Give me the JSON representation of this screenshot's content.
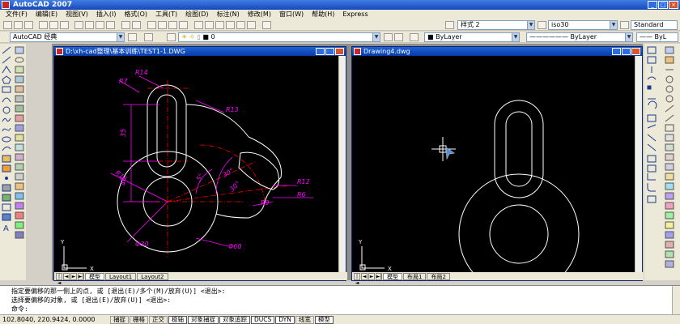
{
  "app": {
    "title": "AutoCAD 2007"
  },
  "menu": [
    "文件(F)",
    "编辑(E)",
    "视图(V)",
    "插入(I)",
    "格式(O)",
    "工具(T)",
    "绘图(D)",
    "标注(N)",
    "修改(M)",
    "窗口(W)",
    "帮助(H)",
    "Express"
  ],
  "toolbar": {
    "text_style": "样式 2",
    "dim_style": "iso30",
    "table_style": "Standard",
    "workspace": "AutoCAD 经典",
    "layer": "0",
    "color": "ByLayer",
    "linetype": "ByLayer",
    "lineweight": "ByL"
  },
  "windows": [
    {
      "title": "D:\\xh-cad整理\\基本训练\\TEST1-1.DWG",
      "tabs": [
        "模型",
        "Layout1",
        "Layout2"
      ],
      "active_tab": "模型"
    },
    {
      "title": "Drawing4.dwg",
      "tabs": [
        "模型",
        "布局1",
        "布局2"
      ],
      "active_tab": "模型"
    }
  ],
  "dims": {
    "r14": "R14",
    "r7": "R7",
    "r13": "R13",
    "r12": "R12",
    "r6": "R6",
    "r9": "R9",
    "r16": "R16",
    "d30": "Φ30",
    "d60": "Φ60",
    "v35": "35",
    "v48": "48",
    "a5": "5°",
    "a30": "30°",
    "a30b": "30°"
  },
  "ucs": {
    "x": "X",
    "y": "Y"
  },
  "command": {
    "line1": "指定要偏移的那一侧上的点, 或 [退出(E)/多个(M)/放弃(U)] <退出>:",
    "line2": "选择要偏移的对象, 或 [退出(E)/放弃(U)] <退出>:",
    "prompt": "命令:"
  },
  "status": {
    "coords": "102.8040, 220.9424, 0.0000",
    "buttons": [
      "捕捉",
      "栅格",
      "正交",
      "极轴",
      "对象捕捉",
      "对象追踪",
      "DUCS",
      "DYN",
      "线宽",
      "模型"
    ],
    "on": [
      "极轴",
      "对象捕捉",
      "对象追踪",
      "DUCS",
      "DYN",
      "模型"
    ]
  },
  "colors": {
    "canvas": "#000000",
    "title_blue": "#1d62d8",
    "dim_magenta": "#ff00ff",
    "center_red": "#ff0000",
    "geometry": "#ffffff"
  }
}
